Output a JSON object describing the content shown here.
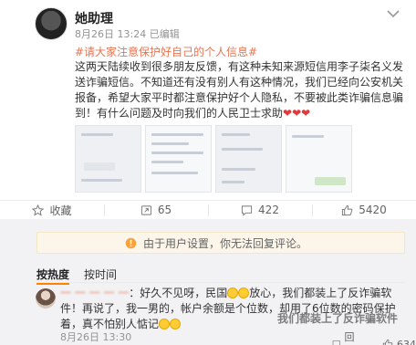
{
  "post": {
    "author": "她助理",
    "timestamp": "8月26日 13:24",
    "edited": "已编辑",
    "topic": "#请大家注意保护好自己的个人信息#",
    "body": "这两天陆续收到很多朋友反馈，有这种未知来源短信用李子柒名义发送诈骗短信。不知道还有没有别人有这种情况，我们已经向公安机关报备，希望大家平时都注意保护好个人隐私，不要被此类诈骗信息骗到！有什么问题及时向我们的人民卫士求助",
    "hearts": "❤❤❤",
    "images_count": 4
  },
  "actions": {
    "favorite_label": "收藏",
    "repost_count": "65",
    "comment_count": "422",
    "like_count": "5420"
  },
  "notice": {
    "text": "由于用户设置，你无法回复评论。"
  },
  "sort": {
    "hot": "按热度",
    "time": "按时间"
  },
  "comment": {
    "username": "一 一 一 一 一",
    "text_part1": "：好久不见呀，民国",
    "text_part2": "放心，我们都装上了反诈骗软件！再说了，我一男的，帐户余额是个位数，却用了6位数的密码保护着，真不怕别人惦记",
    "time": "8月26日 13:30",
    "reply_label": "回复",
    "like_count": "634"
  },
  "watermark": "我们都装上了反诈骗软件",
  "colors": {
    "accent": "#eb7350",
    "notice_bg": "#fbf6e9",
    "active_tab": "#ff8200",
    "heart": "#e4393c"
  },
  "icons": [
    "more-chevron-icon",
    "favorite-icon",
    "repost-icon",
    "comment-icon",
    "like-icon",
    "warning-icon",
    "reply-icon",
    "comment-like-icon"
  ]
}
